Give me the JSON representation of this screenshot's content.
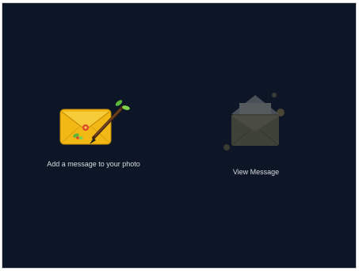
{
  "options": [
    {
      "label": "Add a message to your photo",
      "icon": "envelope-with-brush-icon",
      "state": "enabled"
    },
    {
      "label": "View Message",
      "icon": "open-envelope-icon",
      "state": "disabled"
    }
  ],
  "colors": {
    "background": "#0d1626",
    "envelope_yellow": "#f2b814",
    "envelope_dim": "#3f4238",
    "text": "#d8dbe0"
  }
}
